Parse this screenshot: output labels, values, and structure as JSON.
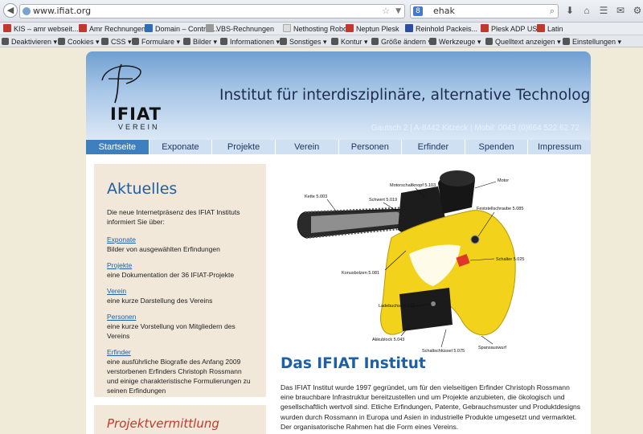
{
  "browser": {
    "url": "www.ifiat.org",
    "search_value": "ehak",
    "search_engine_letter": "8"
  },
  "bookmarks": [
    {
      "label": "KIS – amr webseit...",
      "color": "#c0392b"
    },
    {
      "label": "Amr Rechnungen",
      "color": "#c0392b"
    },
    {
      "label": "Domain – Control...",
      "color": "#2c6fb5"
    },
    {
      "label": "VBS-Rechnungen",
      "color": "#999999"
    },
    {
      "label": "Nethosting Robot",
      "color": "#dddddd"
    },
    {
      "label": "Neptun Plesk",
      "color": "#c0392b"
    },
    {
      "label": "Reinhold Packeis...",
      "color": "#2c4fa3"
    },
    {
      "label": "Plesk ADP USA",
      "color": "#c0392b"
    },
    {
      "label": "Latin",
      "color": "#c0392b"
    }
  ],
  "devtools": [
    "Deaktivieren",
    "Cookies",
    "CSS",
    "Formulare",
    "Bilder",
    "Informationen",
    "Sonstiges",
    "Kontur",
    "Größe ändern",
    "Werkzeuge",
    "Quelltext anzeigen",
    "Einstellungen"
  ],
  "header": {
    "logo_name": "IFIAT",
    "logo_sub": "VEREIN",
    "title": "Institut für interdisziplinäre, alternative Technologie",
    "address": "Gautsch 2 | A-8442 Kitzeck | Mobil: 0043 (0)664 522 62 72"
  },
  "menu": [
    "Startseite",
    "Exponate",
    "Projekte",
    "Verein",
    "Personen",
    "Erfinder",
    "Spenden",
    "Impressum"
  ],
  "sidebar": {
    "heading": "Aktuelles",
    "intro": "Die neue Internetpräsenz des IFIAT Instituts informiert Sie über:",
    "items": [
      {
        "link": "Exponate",
        "desc": "Bilder von ausgewählten Erfindungen"
      },
      {
        "link": "Projekte",
        "desc": "eine Dokumentation der 36 IFIAT-Projekte"
      },
      {
        "link": "Verein",
        "desc": "eine kurze Darstellung des Vereins"
      },
      {
        "link": "Personen",
        "desc": "eine kurze Vorstellung von Mitgliedern des Vereins"
      },
      {
        "link": "Erfinder",
        "desc": "eine ausführliche Biografie des Anfang 2009 verstorbenen Erfinders Christoph Rossmann und einige charakteristische Formulierungen zu seinen Erfindungen"
      }
    ]
  },
  "sidebar2": {
    "heading": "Projektvermittlung"
  },
  "photo_labels": {
    "motorschaltknopf": "Motorschaltknopf 5.103",
    "motor": "Motor",
    "kette": "Kette 5.003",
    "schwert": "Schwert 5.019",
    "feststellschraube": "Feststellschraube 5.085",
    "konusbolzen": "Konusbolzen 5.081",
    "schalter": "Schalter 5.025",
    "ladebuchse": "Ladebuchse 5.112",
    "akkublock": "Akkublock 5.043",
    "schaltschluessel": "Schaltschlüssel 5.075",
    "spansauswurf": "Spansauswurf"
  },
  "main": {
    "title": "Das IFIAT Institut",
    "text": "Das IFIAT Institut wurde 1997 gegründet, um für den vielseitigen Erfinder Christoph Rossmann eine brauchbare Infrastruktur bereitzustellen und um Projekte anzubieten, die ökologisch und gesellschaftlich wertvoll sind. Etliche Erfindungen, Patente, Gebrauchsmuster und Produktdesigns wurden durch Rossmann in Europa und Asien in industrielle Produkte umgesetzt und vermarktet. Der organisatorische Rahmen hat die Form eines Vereins."
  },
  "colors": {
    "accent": "#1f5fa3",
    "active_tab": "#3e7fc0",
    "sidebar_bg": "#f1e8da",
    "highlight_red": "#c0392b"
  }
}
